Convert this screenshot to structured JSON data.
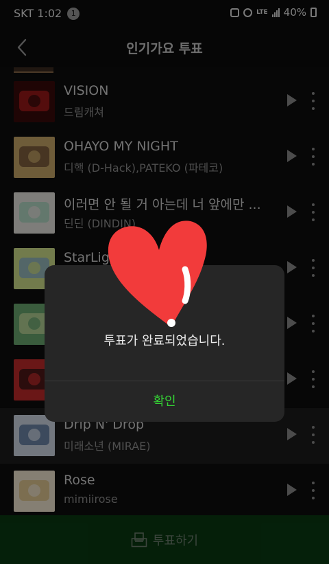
{
  "status_bar": {
    "carrier_time": "SKT 1:02",
    "notification_count": "1",
    "network": "LTE",
    "battery": "40%"
  },
  "header": {
    "title": "인기가요 투표"
  },
  "songs": [
    {
      "title": "VISION",
      "artist": "드림캐쳐",
      "thumb_color": "#3a0a0a",
      "thumb_accent": "#c22",
      "highlighted": false
    },
    {
      "title": "OHAYO MY NIGHT",
      "artist": "디핵 (D-Hack),PATEKO (파테코)",
      "thumb_color": "#c8a868",
      "thumb_accent": "#5a3a2a",
      "highlighted": false
    },
    {
      "title": "이러면 안 될 거 아는데 너 앞에만 ...",
      "artist": "딘딘 (DINDIN)",
      "thumb_color": "#e6e4de",
      "thumb_accent": "#9bd4b8",
      "highlighted": false
    },
    {
      "title": "StarLight",
      "artist": "",
      "thumb_color": "#cfe08a",
      "thumb_accent": "#7aa7d8",
      "highlighted": false
    },
    {
      "title": "",
      "artist": "",
      "thumb_color": "#6aa870",
      "thumb_accent": "#d8e6a8",
      "highlighted": false
    },
    {
      "title": "",
      "artist": "",
      "thumb_color": "#c22a2a",
      "thumb_accent": "#111111",
      "highlighted": false
    },
    {
      "title": "Drip N' Drop",
      "artist": "미래소년 (MIRAE)",
      "thumb_color": "#cfd9e6",
      "thumb_accent": "#3a5a8a",
      "highlighted": true
    },
    {
      "title": "Rose",
      "artist": "mimiirose",
      "thumb_color": "#f2e7d2",
      "thumb_accent": "#d8b870",
      "highlighted": false
    }
  ],
  "dialog": {
    "message": "투표가 완료되었습니다.",
    "confirm_label": "확인"
  },
  "vote_button": {
    "label": "투표하기"
  },
  "colors": {
    "accent_green": "#35d335",
    "vote_bar": "#0a3a12",
    "heart_red": "#f23b3b"
  }
}
